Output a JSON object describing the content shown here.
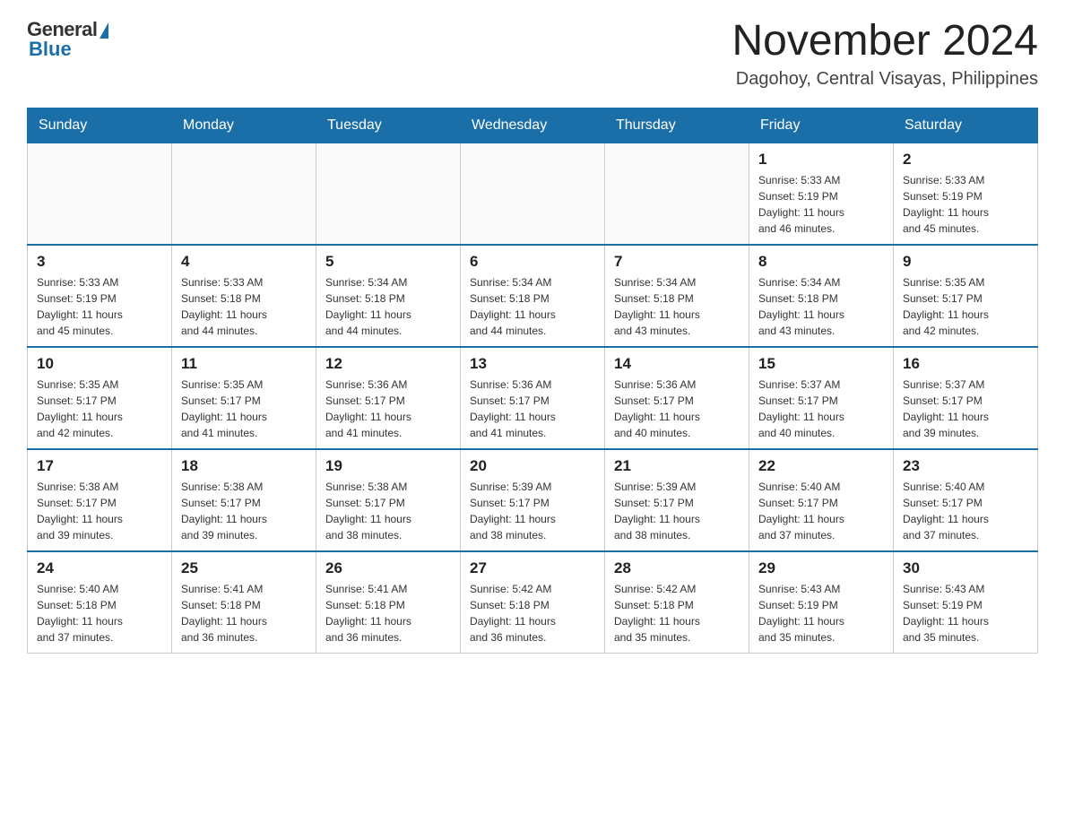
{
  "header": {
    "logo_general": "General",
    "logo_blue": "Blue",
    "month_title": "November 2024",
    "location": "Dagohoy, Central Visayas, Philippines"
  },
  "weekdays": [
    "Sunday",
    "Monday",
    "Tuesday",
    "Wednesday",
    "Thursday",
    "Friday",
    "Saturday"
  ],
  "weeks": [
    [
      {
        "day": "",
        "info": ""
      },
      {
        "day": "",
        "info": ""
      },
      {
        "day": "",
        "info": ""
      },
      {
        "day": "",
        "info": ""
      },
      {
        "day": "",
        "info": ""
      },
      {
        "day": "1",
        "info": "Sunrise: 5:33 AM\nSunset: 5:19 PM\nDaylight: 11 hours\nand 46 minutes."
      },
      {
        "day": "2",
        "info": "Sunrise: 5:33 AM\nSunset: 5:19 PM\nDaylight: 11 hours\nand 45 minutes."
      }
    ],
    [
      {
        "day": "3",
        "info": "Sunrise: 5:33 AM\nSunset: 5:19 PM\nDaylight: 11 hours\nand 45 minutes."
      },
      {
        "day": "4",
        "info": "Sunrise: 5:33 AM\nSunset: 5:18 PM\nDaylight: 11 hours\nand 44 minutes."
      },
      {
        "day": "5",
        "info": "Sunrise: 5:34 AM\nSunset: 5:18 PM\nDaylight: 11 hours\nand 44 minutes."
      },
      {
        "day": "6",
        "info": "Sunrise: 5:34 AM\nSunset: 5:18 PM\nDaylight: 11 hours\nand 44 minutes."
      },
      {
        "day": "7",
        "info": "Sunrise: 5:34 AM\nSunset: 5:18 PM\nDaylight: 11 hours\nand 43 minutes."
      },
      {
        "day": "8",
        "info": "Sunrise: 5:34 AM\nSunset: 5:18 PM\nDaylight: 11 hours\nand 43 minutes."
      },
      {
        "day": "9",
        "info": "Sunrise: 5:35 AM\nSunset: 5:17 PM\nDaylight: 11 hours\nand 42 minutes."
      }
    ],
    [
      {
        "day": "10",
        "info": "Sunrise: 5:35 AM\nSunset: 5:17 PM\nDaylight: 11 hours\nand 42 minutes."
      },
      {
        "day": "11",
        "info": "Sunrise: 5:35 AM\nSunset: 5:17 PM\nDaylight: 11 hours\nand 41 minutes."
      },
      {
        "day": "12",
        "info": "Sunrise: 5:36 AM\nSunset: 5:17 PM\nDaylight: 11 hours\nand 41 minutes."
      },
      {
        "day": "13",
        "info": "Sunrise: 5:36 AM\nSunset: 5:17 PM\nDaylight: 11 hours\nand 41 minutes."
      },
      {
        "day": "14",
        "info": "Sunrise: 5:36 AM\nSunset: 5:17 PM\nDaylight: 11 hours\nand 40 minutes."
      },
      {
        "day": "15",
        "info": "Sunrise: 5:37 AM\nSunset: 5:17 PM\nDaylight: 11 hours\nand 40 minutes."
      },
      {
        "day": "16",
        "info": "Sunrise: 5:37 AM\nSunset: 5:17 PM\nDaylight: 11 hours\nand 39 minutes."
      }
    ],
    [
      {
        "day": "17",
        "info": "Sunrise: 5:38 AM\nSunset: 5:17 PM\nDaylight: 11 hours\nand 39 minutes."
      },
      {
        "day": "18",
        "info": "Sunrise: 5:38 AM\nSunset: 5:17 PM\nDaylight: 11 hours\nand 39 minutes."
      },
      {
        "day": "19",
        "info": "Sunrise: 5:38 AM\nSunset: 5:17 PM\nDaylight: 11 hours\nand 38 minutes."
      },
      {
        "day": "20",
        "info": "Sunrise: 5:39 AM\nSunset: 5:17 PM\nDaylight: 11 hours\nand 38 minutes."
      },
      {
        "day": "21",
        "info": "Sunrise: 5:39 AM\nSunset: 5:17 PM\nDaylight: 11 hours\nand 38 minutes."
      },
      {
        "day": "22",
        "info": "Sunrise: 5:40 AM\nSunset: 5:17 PM\nDaylight: 11 hours\nand 37 minutes."
      },
      {
        "day": "23",
        "info": "Sunrise: 5:40 AM\nSunset: 5:17 PM\nDaylight: 11 hours\nand 37 minutes."
      }
    ],
    [
      {
        "day": "24",
        "info": "Sunrise: 5:40 AM\nSunset: 5:18 PM\nDaylight: 11 hours\nand 37 minutes."
      },
      {
        "day": "25",
        "info": "Sunrise: 5:41 AM\nSunset: 5:18 PM\nDaylight: 11 hours\nand 36 minutes."
      },
      {
        "day": "26",
        "info": "Sunrise: 5:41 AM\nSunset: 5:18 PM\nDaylight: 11 hours\nand 36 minutes."
      },
      {
        "day": "27",
        "info": "Sunrise: 5:42 AM\nSunset: 5:18 PM\nDaylight: 11 hours\nand 36 minutes."
      },
      {
        "day": "28",
        "info": "Sunrise: 5:42 AM\nSunset: 5:18 PM\nDaylight: 11 hours\nand 35 minutes."
      },
      {
        "day": "29",
        "info": "Sunrise: 5:43 AM\nSunset: 5:19 PM\nDaylight: 11 hours\nand 35 minutes."
      },
      {
        "day": "30",
        "info": "Sunrise: 5:43 AM\nSunset: 5:19 PM\nDaylight: 11 hours\nand 35 minutes."
      }
    ]
  ]
}
